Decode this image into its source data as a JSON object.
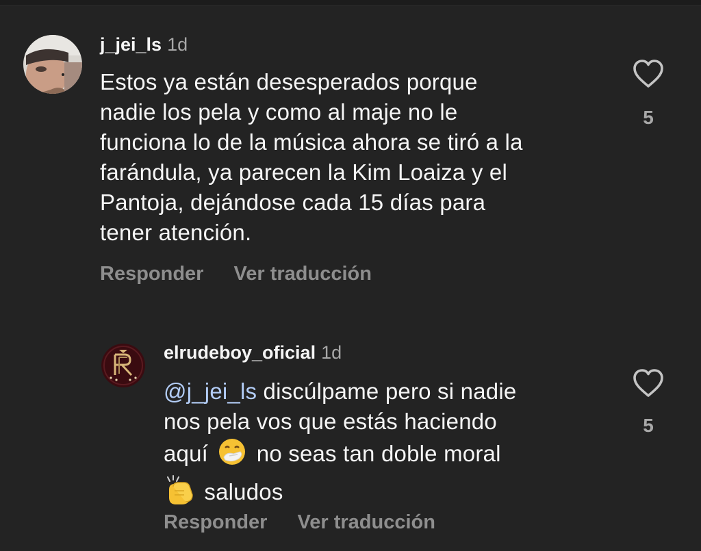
{
  "comments": [
    {
      "username": "j_jei_ls",
      "time": "1d",
      "lines": [
        "Estos ya están desesperados porque",
        "nadie los pela y como al maje no le",
        "funciona lo de la música ahora se tiró a la",
        "farándula, ya parecen la Kim Loaiza y el",
        "Pantoja, dejándose cada 15 días para",
        "tener atención."
      ],
      "like_count": "5",
      "reply_label": "Responder",
      "translate_label": "Ver traducción"
    },
    {
      "username": "elrudeboy_oficial",
      "time": "1d",
      "mention": "@j_jei_ls",
      "line1_rest": " discúlpame pero si nadie",
      "line2": "nos pela vos que estás haciendo",
      "line3_a": "aquí",
      "line3_b": "no seas tan doble moral",
      "line4_rest": "saludos",
      "like_count": "5",
      "reply_label": "Responder",
      "translate_label": "Ver traducción"
    }
  ],
  "icons": {
    "like": "heart-outline-icon",
    "emoji_sneeze": "sneezing-face-emoji",
    "emoji_clap": "clapping-hands-emoji"
  },
  "colors": {
    "background": "#232323",
    "mention": "#b3cdf7",
    "secondary_text": "#8e8e8e"
  }
}
